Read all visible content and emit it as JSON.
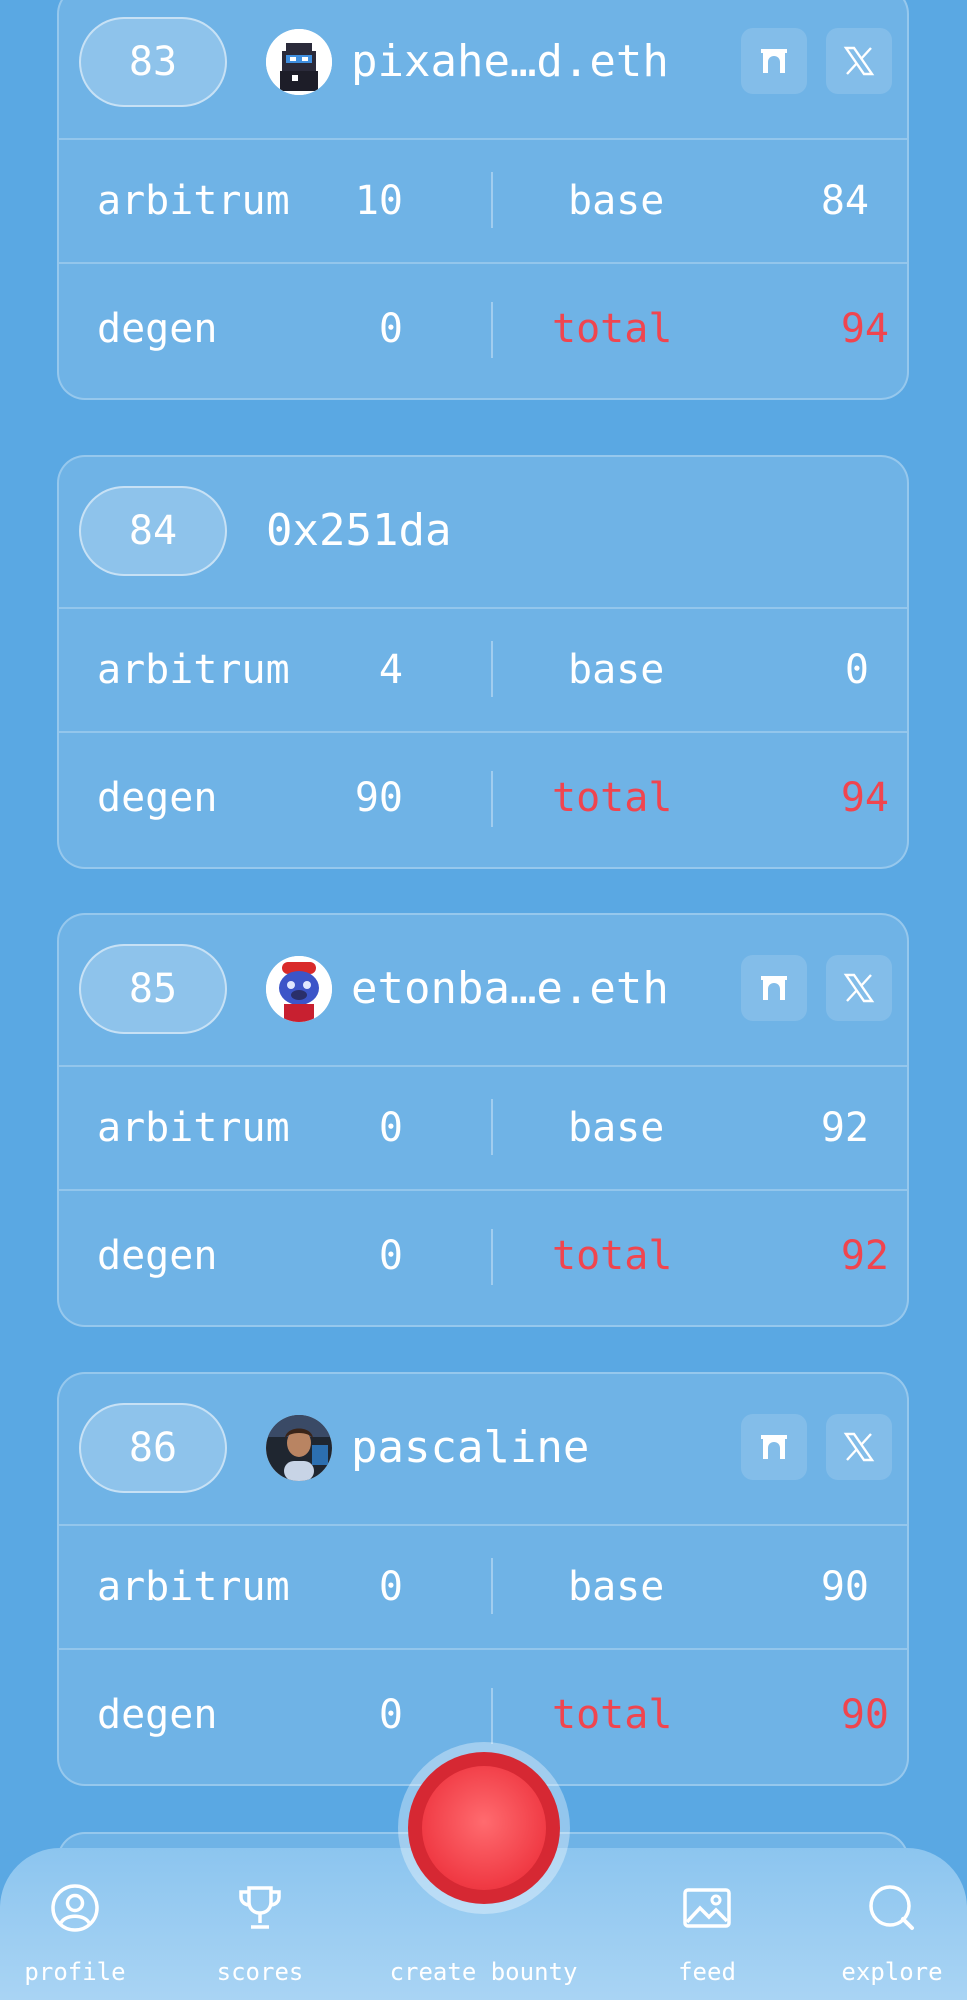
{
  "entries": [
    {
      "rank": "83",
      "name": "pixahe…d.eth",
      "avatar": "pixel-cat-avatar",
      "has_links": true,
      "stats": {
        "arbitrum_label": "arbitrum",
        "arbitrum": "10",
        "base_label": "base",
        "base": "84",
        "degen_label": "degen",
        "degen": "0",
        "total_label": "total",
        "total": "94"
      }
    },
    {
      "rank": "84",
      "name": "0x251da",
      "avatar": null,
      "has_links": false,
      "stats": {
        "arbitrum_label": "arbitrum",
        "arbitrum": "4",
        "base_label": "base",
        "base": "0",
        "degen_label": "degen",
        "degen": "90",
        "total_label": "total",
        "total": "94"
      }
    },
    {
      "rank": "85",
      "name": "etonba…e.eth",
      "avatar": "blue-dog-avatar",
      "has_links": true,
      "stats": {
        "arbitrum_label": "arbitrum",
        "arbitrum": "0",
        "base_label": "base",
        "base": "92",
        "degen_label": "degen",
        "degen": "0",
        "total_label": "total",
        "total": "92"
      }
    },
    {
      "rank": "86",
      "name": "pascaline",
      "avatar": "person-photo-avatar",
      "has_links": true,
      "stats": {
        "arbitrum_label": "arbitrum",
        "arbitrum": "0",
        "base_label": "base",
        "base": "90",
        "degen_label": "degen",
        "degen": "0",
        "total_label": "total",
        "total": "90"
      }
    }
  ],
  "icons": {
    "farcaster": "farcaster-arch-icon",
    "x": "x-logo-icon"
  },
  "nav": {
    "profile": "profile",
    "scores": "scores",
    "create_bounty": "create bounty",
    "feed": "feed",
    "explore": "explore"
  },
  "colors": {
    "background": "#5aa8e3",
    "total_red": "#f0454f",
    "record_red": "#f03a44"
  }
}
